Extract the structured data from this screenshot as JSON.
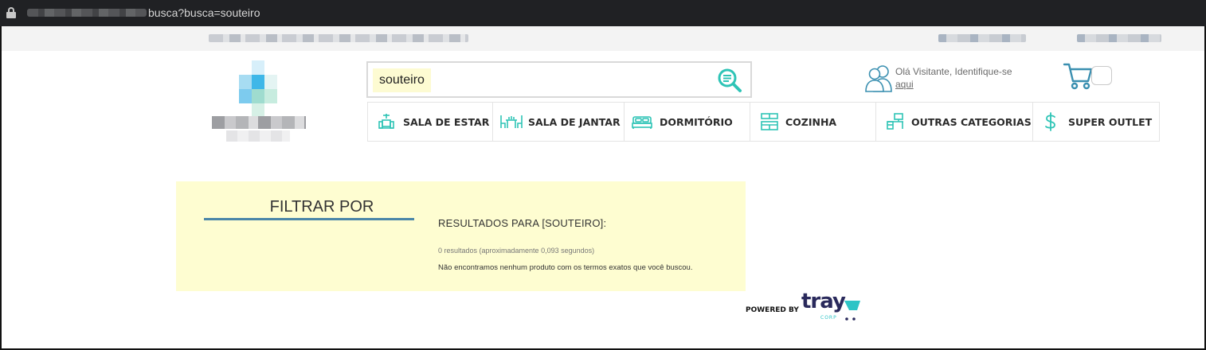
{
  "browser": {
    "url_visible": "busca?busca=souteiro"
  },
  "search": {
    "value": "souteiro"
  },
  "user": {
    "greeting": "Olá Visitante, Identifique-se",
    "link": "aqui"
  },
  "menu": {
    "items": [
      {
        "label": "SALA DE ESTAR",
        "icon": "living-room-icon"
      },
      {
        "label": "SALA DE JANTAR",
        "icon": "dining-room-icon"
      },
      {
        "label": "DORMITÓRIO",
        "icon": "bed-icon"
      },
      {
        "label": "COZINHA",
        "icon": "kitchen-icon"
      },
      {
        "label": "OUTRAS CATEGORIAS",
        "icon": "desk-icon"
      },
      {
        "label": "SUPER OUTLET",
        "icon": "dollar-icon"
      }
    ]
  },
  "filters": {
    "title": "FILTRAR POR"
  },
  "results": {
    "title": "RESULTADOS PARA [SOUTEIRO]:",
    "count": "0 resultados (aproximadamente 0,093 segundos)",
    "message": "Não encontramos nenhum produto com os termos exatos que você buscou."
  },
  "footer": {
    "powered_by": "POWERED BY",
    "brand": "tray",
    "brand_sub": "CORP"
  },
  "colors": {
    "accent": "#2ec4b6",
    "panel_bg": "#fefdd1",
    "filter_underline": "#4a86a8"
  }
}
